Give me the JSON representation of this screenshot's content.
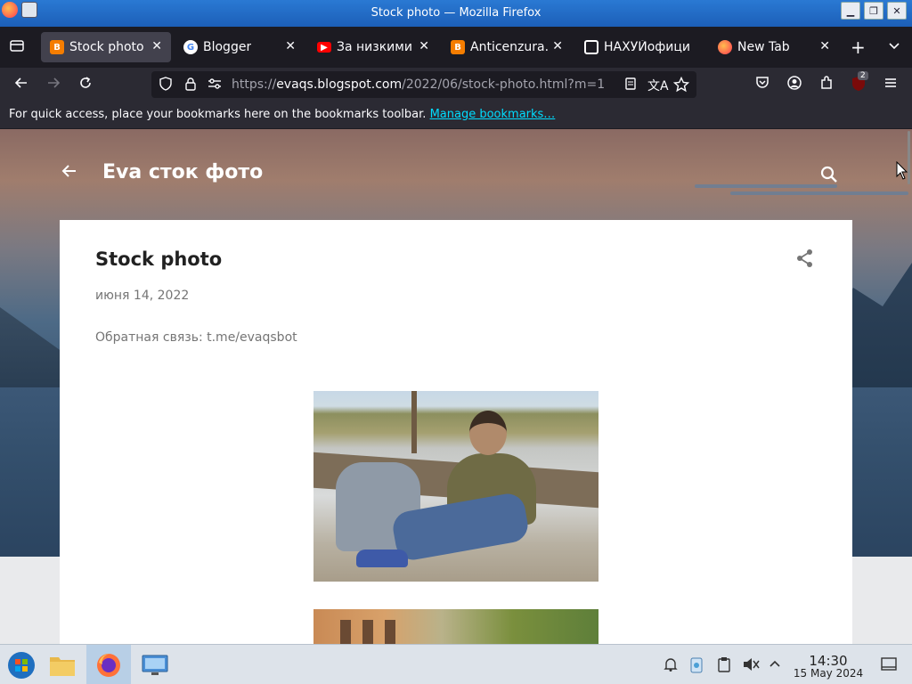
{
  "window": {
    "title": "Stock photo — Mozilla Firefox"
  },
  "tabs": [
    {
      "label": "Stock photo",
      "favicon": "blogger-icon",
      "color": "#f57d00",
      "active": true
    },
    {
      "label": "Blogger",
      "favicon": "google-icon",
      "color": "#ffffff",
      "active": false
    },
    {
      "label": "За низкими ц",
      "favicon": "youtube-icon",
      "color": "#ff0000",
      "active": false
    },
    {
      "label": "Anticenzura.",
      "favicon": "blogger-icon",
      "color": "#f57d00",
      "active": false
    },
    {
      "label": "НАХУЙофици",
      "favicon": "circle-icon",
      "color": "#ffffff",
      "active": false
    },
    {
      "label": "New Tab",
      "favicon": "firefox-icon",
      "color": "#ff7139",
      "active": false
    }
  ],
  "urlbar": {
    "prefix": "https://",
    "host": "evaqs.blogspot.com",
    "path": "/2022/06/stock-photo.html?m=1"
  },
  "extension_badge": "2",
  "bookmarks_bar": {
    "message": "For quick access, place your bookmarks here on the bookmarks toolbar.",
    "link": "Manage bookmarks…"
  },
  "blog": {
    "title": "Eva сток фото",
    "post_title": "Stock photo",
    "post_date": "июня 14, 2022",
    "post_body": "Обратная связь: t.me/evaqsbot"
  },
  "taskbar": {
    "time": "14:30",
    "date": "15 May 2024"
  }
}
